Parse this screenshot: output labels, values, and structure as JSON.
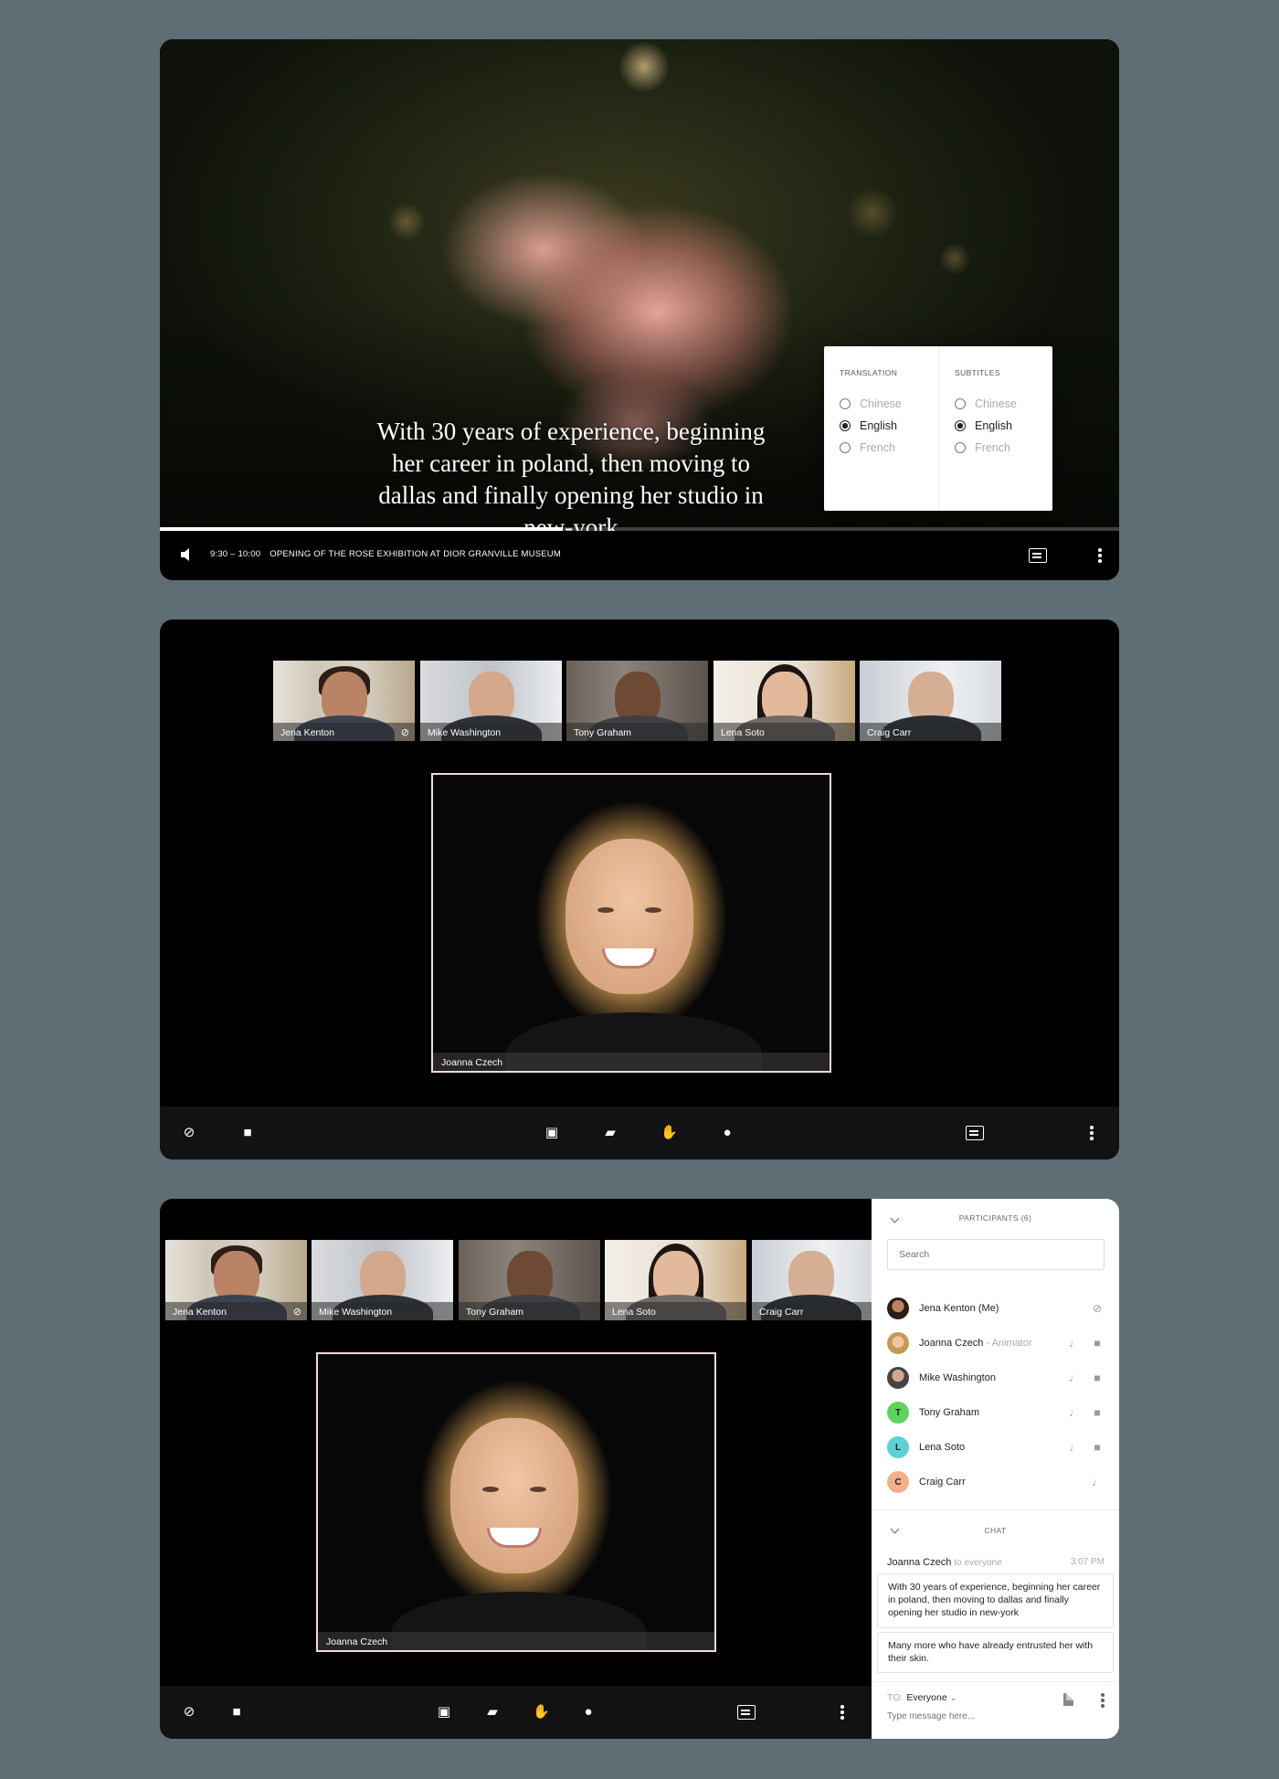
{
  "player": {
    "subtitle": "With 30 years of experience, beginning her career in poland, then moving to dallas and finally opening her studio in new-york",
    "time_range": "9:30 – 10:00",
    "event_title": "OPENING OF THE ROSE EXHIBITION AT DIOR GRANVILLE MUSEUM",
    "progress": 0.42,
    "lang_popup": {
      "translation_heading": "TRANSLATION",
      "subtitles_heading": "SUBTITLES",
      "translation_options": [
        "Chinese",
        "English",
        "French"
      ],
      "subtitles_options": [
        "Chinese",
        "English",
        "French"
      ],
      "translation_selected": "English",
      "subtitles_selected": "English"
    }
  },
  "participants_strip": [
    "Jena Kenton",
    "Mike Washington",
    "Tony Graham",
    "Lena Soto",
    "Craig Carr"
  ],
  "main_speaker": "Joanna Czech",
  "sidebar": {
    "participants_heading": "PARTICIPANTS (6)",
    "search_placeholder": "Search",
    "participants": [
      {
        "name": "Jena Kenton (Me)",
        "role": "",
        "avatar": "photo",
        "icons": [
          "mic-off-icon"
        ]
      },
      {
        "name": "Joanna Czech",
        "role": "- Animator",
        "avatar": "photo",
        "icons": [
          "mic-icon",
          "camera-icon"
        ]
      },
      {
        "name": "Mike Washington",
        "role": "",
        "avatar": "photo",
        "icons": [
          "mic-icon",
          "camera-icon"
        ]
      },
      {
        "name": "Tony Graham",
        "role": "",
        "avatar": "T",
        "avatar_color": "#5fd35b",
        "icons": [
          "mic-icon",
          "camera-icon"
        ]
      },
      {
        "name": "Lena Soto",
        "role": "",
        "avatar": "L",
        "avatar_color": "#5fd1d6",
        "icons": [
          "mic-icon",
          "camera-icon"
        ]
      },
      {
        "name": "Craig Carr",
        "role": "",
        "avatar": "C",
        "avatar_color": "#f2b08a",
        "icons": [
          "mic-icon"
        ]
      }
    ],
    "chat_heading": "CHAT",
    "chat": {
      "sender": "Joanna Czech",
      "recipient": "to everyone",
      "time": "3:07 PM",
      "messages": [
        "With 30 years of experience, beginning her career in poland, then moving to dallas and finally opening her studio in new-york",
        "Many more who have already entrusted her with their skin."
      ]
    },
    "compose": {
      "to_label": "TO:",
      "to_value": "Everyone",
      "placeholder": "Type message here..."
    }
  },
  "colors": {
    "background": "#5f6d74",
    "speaker_border": "#f5dad0",
    "control_bar": "#121214"
  }
}
